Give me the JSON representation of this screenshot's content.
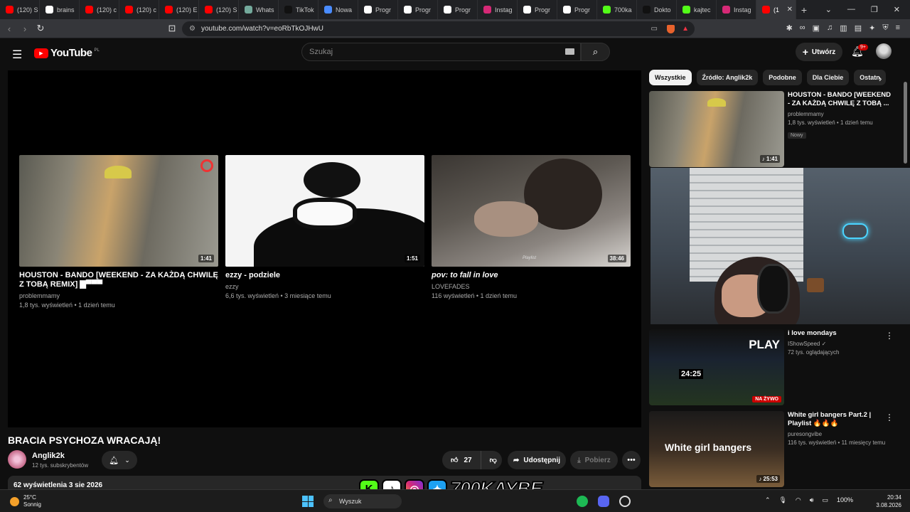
{
  "browser": {
    "tabs": [
      {
        "label": "(120) S",
        "icon": "youtube-icon"
      },
      {
        "label": "brains",
        "icon": "google-icon"
      },
      {
        "label": "(120) c",
        "icon": "youtube-icon"
      },
      {
        "label": "(120) c",
        "icon": "youtube-icon"
      },
      {
        "label": "(120) E",
        "icon": "youtube-icon"
      },
      {
        "label": "(120) S",
        "icon": "youtube-icon"
      },
      {
        "label": "Whats",
        "icon": "chatgpt-icon"
      },
      {
        "label": "TikTok",
        "icon": "tiktok-icon"
      },
      {
        "label": "Nowa",
        "icon": "globe-icon"
      },
      {
        "label": "Progr",
        "icon": "google-icon"
      },
      {
        "label": "Progr",
        "icon": "google-icon"
      },
      {
        "label": "Progr",
        "icon": "google-icon"
      },
      {
        "label": "Instag",
        "icon": "instagram-icon"
      },
      {
        "label": "Progr",
        "icon": "google-icon"
      },
      {
        "label": "Progr",
        "icon": "google-icon"
      },
      {
        "label": "700ka",
        "icon": "kick-icon"
      },
      {
        "label": "Dokto",
        "icon": "tiktok-icon"
      },
      {
        "label": "kajtec",
        "icon": "kick-icon"
      },
      {
        "label": "Instag",
        "icon": "instagram-icon"
      },
      {
        "label": "(1",
        "icon": "youtube-icon"
      }
    ],
    "url": "youtube.com/watch?v=eoRbTkOJHwU"
  },
  "header": {
    "logo_text": "YouTube",
    "logo_country": "PL",
    "search_placeholder": "Szukaj",
    "create_label": "Utwórz",
    "notif_count": "9+"
  },
  "endscreen": [
    {
      "title": "HOUSTON - BANDO [WEEKEND - ZA KAŻDĄ CHWILĘ Z TOBĄ REMIX] ▇▀▀▀",
      "channel": "problemmamy",
      "meta": "1,8 tys. wyświetleń • 1 dzień temu",
      "duration": "1:41"
    },
    {
      "title": "ezzy - podziele",
      "channel": "ezzy",
      "meta": "6,6 tys. wyświetleń • 3 miesiące temu",
      "duration": "1:51"
    },
    {
      "title": "pov: to fall in love",
      "channel": "LOVEFADES",
      "meta": "116 wyświetleń • 1 dzień temu",
      "duration": "38:46",
      "thumb_caption": "Playlist"
    }
  ],
  "video": {
    "title": "BRACIA PSYCHOZA WRACAJĄ!",
    "channel": "Anglik2k",
    "subs": "12 tys. subskrybentów",
    "likes": "27",
    "share_label": "Udostępnij",
    "download_label": "Pobierz",
    "more_label": "•••",
    "views_date": "62 wyświetlenia  3 sie 2026"
  },
  "sidebar": {
    "chips": [
      "Wszystkie",
      "Źródło: Anglik2k",
      "Podobne",
      "Dla Ciebie",
      "Ostatn"
    ],
    "related": [
      {
        "title": "HOUSTON - BANDO [WEEKEND - ZA KAŻDĄ CHWILĘ Z TOBĄ ...",
        "channel": "problemmamy",
        "meta": "1,8 tys. wyświetleń • 1 dzień temu",
        "badge": "Nowy",
        "duration": "♪ 1:41"
      },
      {
        "title": "i love mondays",
        "channel": "IShowSpeed ✓",
        "meta": "72 tys. oglądających",
        "live": "NA ŻYWO",
        "thumb_text": "PLAY",
        "timer": "24:25"
      },
      {
        "title": "White girl bangers Part.2 | Playlist 🔥🔥🔥",
        "channel": "puresongvibe",
        "meta": "116 tys. wyświetleń • 11 miesięcy temu",
        "duration": "♪ 25:53",
        "thumb_text": "White girl bangers"
      }
    ]
  },
  "overlay": {
    "brand_text": "700KAYBE"
  },
  "taskbar": {
    "temp": "25°C",
    "weather": "Sonnig",
    "search": "Wyszuk",
    "battery": "100%",
    "time": "20:34",
    "date": "3.08.2026"
  },
  "colors": {
    "accent": "#ff0000",
    "bg": "#0f0f0f",
    "surface": "#272727"
  }
}
